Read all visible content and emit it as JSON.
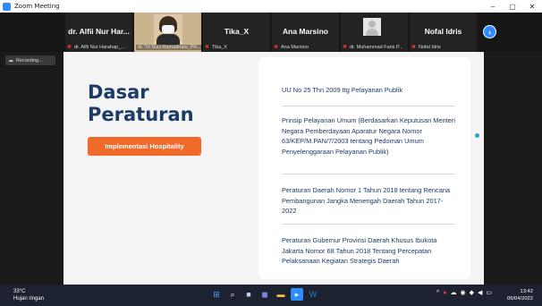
{
  "window": {
    "title": "Zoom Meeting",
    "controls": [
      "–",
      "▢",
      "✕"
    ]
  },
  "participants": [
    {
      "big_name": "dr. Alfii Nur Har...",
      "small_name": "dr. Alfii Nur Harahap_...",
      "muted": true
    },
    {
      "big_name": "",
      "small_name": "dr. Tri Suci Ramadhani_PK...",
      "muted": false,
      "video": true
    },
    {
      "big_name": "Tika_X",
      "small_name": "Tika_X",
      "muted": true
    },
    {
      "big_name": "Ana Marsino",
      "small_name": "Ana Marsino",
      "muted": true
    },
    {
      "big_name": "",
      "small_name": "dr. Muhammad Faris P...",
      "muted": true,
      "avatar": true
    },
    {
      "big_name": "Nofal Idris",
      "small_name": "Nofal Idris",
      "muted": true
    }
  ],
  "next_label": "›",
  "recording": {
    "icon": "cloud-icon",
    "label": "Recording..."
  },
  "slide": {
    "title_line1": "Dasar",
    "title_line2": "Peraturan",
    "tag": "Implementasi Hospitality",
    "items": [
      "UU No 25 Thn 2009 ttg Pelayanan Publik",
      "Prinsip Pelayanan Umum (Berdasarkan Keputusan Menteri Negara Pemberdayaan Aparatur Negara Nomor 63/KEP/M.PAN/7/2003 tentang Pedoman Umum Penyelenggaraan Pelayanan Publik)",
      "Peraturan Daerah Nomor 1 Tahun 2018 tentang Rencana Pembangunan Jangka Menengah Daerah Tahun 2017-2022",
      "Peraturan Gubernur Provinsi Daerah Khusus Ibukota Jakarta Nomor 68 Tahun 2018 Tentang Percepatan Pelaksanaan Kegiatan Strategis Daerah"
    ]
  },
  "taskbar": {
    "weather_temp": "33°C",
    "weather_desc": "Hujan ringan",
    "apps": [
      "start-icon",
      "search-icon",
      "camera-icon",
      "chat-icon",
      "folder-icon",
      "zoom-icon",
      "word-icon"
    ],
    "tray": [
      "^",
      "●",
      "☁",
      "◉",
      "◆",
      "◀",
      "▭"
    ],
    "time": "13:42",
    "date": "06/04/2022"
  },
  "colors": {
    "accent": "#f06a2a",
    "title": "#1c3b66",
    "zoom_blue": "#2d8cff"
  }
}
